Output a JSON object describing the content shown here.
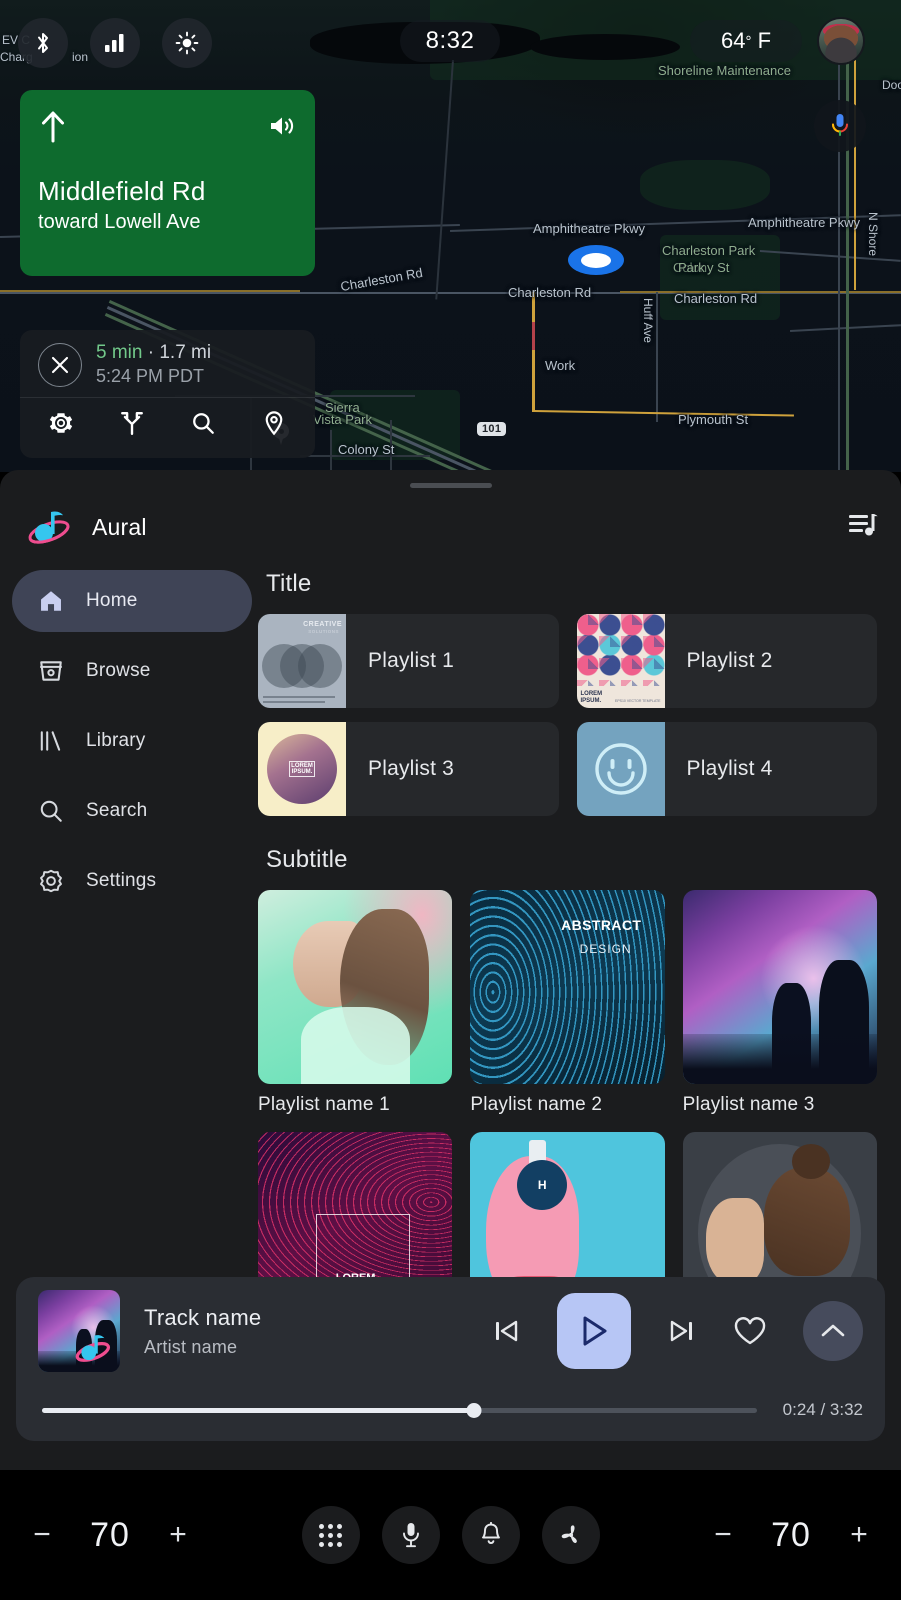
{
  "status_bar": {
    "bluetooth_icon": "bluetooth-icon",
    "signal_icon": "signal-bars-icon",
    "brightness_icon": "brightness-icon",
    "background_text_1": "EV C",
    "background_text_2": "Charg",
    "background_text_3": "ion",
    "clock": "8:32",
    "temperature": "64",
    "temperature_degree": "°",
    "temperature_unit": "F",
    "avatar_name": "user-avatar"
  },
  "map": {
    "assistant_button": "assistant-mic-icon",
    "labels": [
      "Shoreline Maintenance",
      "Amphitheatre Pkwy",
      "Amphitheatre Pkwy",
      "Charleston Park",
      "Charleston Rd",
      "Charleston Rd",
      "Charleston Rd",
      "Huff Ave",
      "N Shore",
      "Work",
      "Plymouth St",
      "Sierra",
      "Vista Park",
      "Colony St",
      "Doo"
    ],
    "highway_shield": "101"
  },
  "navigation": {
    "maneuver_icon": "straight-arrow-icon",
    "sound_icon": "volume-on-icon",
    "street": "Middlefield Rd",
    "toward": "toward Lowell Ave",
    "eta": {
      "close_icon": "close-icon",
      "duration": "5 min",
      "separator": " · ",
      "distance": "1.7 mi",
      "arrival": "5:24 PM PDT",
      "tools": [
        {
          "name": "settings-icon"
        },
        {
          "name": "route-alternatives-icon"
        },
        {
          "name": "search-icon"
        },
        {
          "name": "place-pin-icon"
        }
      ]
    }
  },
  "music_app": {
    "logo": "aural-logo-icon",
    "name": "Aural",
    "queue_icon": "queue-music-icon",
    "sidebar": [
      {
        "label": "Home",
        "icon": "home-icon",
        "active": true
      },
      {
        "label": "Browse",
        "icon": "browse-icon",
        "active": false
      },
      {
        "label": "Library",
        "icon": "library-icon",
        "active": false
      },
      {
        "label": "Search",
        "icon": "search-icon",
        "active": false
      },
      {
        "label": "Settings",
        "icon": "settings-gear-icon",
        "active": false
      }
    ],
    "section_title": "Title",
    "section_subtitle": "Subtitle",
    "playlist_rows": [
      {
        "label": "Playlist 1",
        "art": "creative-solutions-cover"
      },
      {
        "label": "Playlist 2",
        "art": "geometric-pattern-cover"
      },
      {
        "label": "Playlist 3",
        "art": "lorem-ipsum-sphere-cover"
      },
      {
        "label": "Playlist 4",
        "art": "smiley-face-cover"
      }
    ],
    "playlist_tiles": [
      {
        "label": "Playlist name 1",
        "art": "woman-mint-gradient-cover"
      },
      {
        "label": "Playlist name 2",
        "art": "abstract-design-cover"
      },
      {
        "label": "Playlist name 3",
        "art": "concert-stage-cover"
      }
    ],
    "playlist_tiles_row2": [
      {
        "label": "",
        "art": "lorem-wave-cover"
      },
      {
        "label": "",
        "art": "pink-hair-headphones-cover"
      },
      {
        "label": "",
        "art": "clapping-woman-cover"
      }
    ],
    "art_text": {
      "creative_line1": "CREATIVE",
      "creative_line2": "SOLUTIONS",
      "geo_lorem1": "LOREM",
      "geo_lorem2": "IPSUM.",
      "sphere_lorem1": "LOREM",
      "sphere_lorem2": "IPSUM.",
      "abstract_line1": "ABSTRACT",
      "abstract_line2": "DESIGN",
      "wave_lorem": "LOREM"
    }
  },
  "player": {
    "album_art": "concert-stage-album-art",
    "track_name": "Track name",
    "artist_name": "Artist name",
    "previous_icon": "skip-previous-icon",
    "play_icon": "play-icon",
    "next_icon": "skip-next-icon",
    "favorite_icon": "heart-outline-icon",
    "expand_icon": "chevron-up-icon",
    "elapsed": "0:24",
    "duration": "3:32",
    "time_display": "0:24 / 3:32",
    "progress_percent": 60.5
  },
  "system_bar": {
    "volume_left": {
      "minus": "−",
      "value": "70",
      "plus": "+"
    },
    "volume_right": {
      "minus": "−",
      "value": "70",
      "plus": "+"
    },
    "buttons": [
      {
        "name": "apps-grid-icon"
      },
      {
        "name": "microphone-icon"
      },
      {
        "name": "notifications-bell-icon"
      },
      {
        "name": "climate-fan-icon"
      }
    ]
  },
  "colors": {
    "nav_green": "#0e6b2e",
    "accent_play": "#b7c6f5",
    "active_nav_pill": "#3f4456",
    "panel_bg": "#1b1c1e",
    "player_bg": "#2a2d33",
    "eta_green": "#72c98a"
  }
}
